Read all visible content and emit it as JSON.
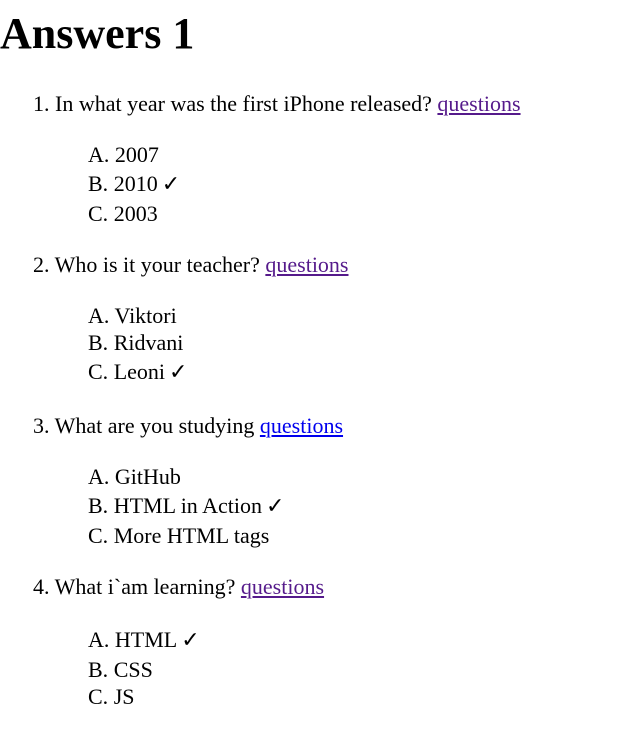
{
  "title": "Answers 1",
  "link_label": "questions",
  "check_mark": "✓",
  "link_colors": {
    "visited": "#551a8b",
    "unvisited": "#0000ee"
  },
  "questions": [
    {
      "number": "1.",
      "text": "In what year was the first iPhone released?",
      "answers": [
        {
          "letter": "A.",
          "text": "2007",
          "correct": false
        },
        {
          "letter": "B.",
          "text": "2010",
          "correct": true
        },
        {
          "letter": "C.",
          "text": "2003",
          "correct": false
        }
      ]
    },
    {
      "number": "2.",
      "text": "Who is it your teacher?",
      "answers": [
        {
          "letter": "A.",
          "text": "Viktori",
          "correct": false
        },
        {
          "letter": "B.",
          "text": "Ridvani",
          "correct": false
        },
        {
          "letter": "C.",
          "text": "Leoni",
          "correct": true
        }
      ]
    },
    {
      "number": "3.",
      "text": "What are you studying",
      "answers": [
        {
          "letter": "A.",
          "text": "GitHub",
          "correct": false
        },
        {
          "letter": "B.",
          "text": "HTML in Action",
          "correct": true
        },
        {
          "letter": "C.",
          "text": "More HTML tags",
          "correct": false
        }
      ]
    },
    {
      "number": "4.",
      "text": "What i`am learning?",
      "answers": [
        {
          "letter": "A.",
          "text": "HTML",
          "correct": true
        },
        {
          "letter": "B.",
          "text": "CSS",
          "correct": false
        },
        {
          "letter": "C.",
          "text": "JS",
          "correct": false
        }
      ]
    }
  ]
}
